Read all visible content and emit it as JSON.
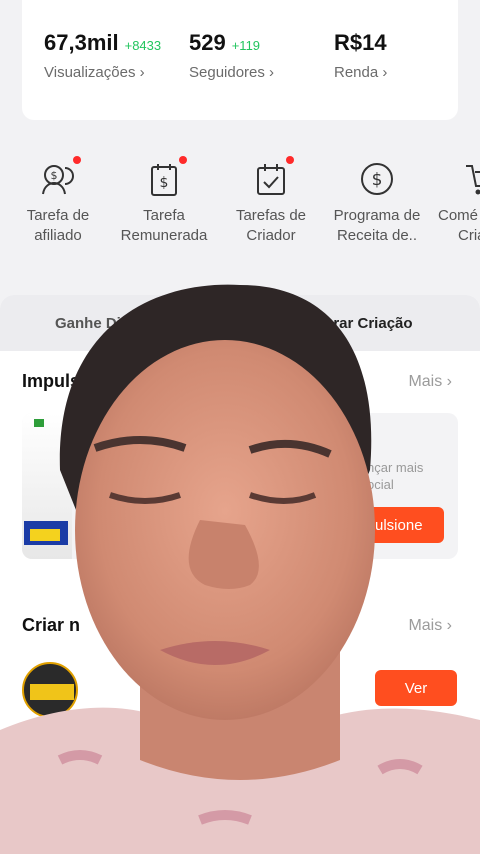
{
  "stats": [
    {
      "value": "67,3mil",
      "delta": "+8433",
      "label": "Visualizações ›"
    },
    {
      "value": "529",
      "delta": "+119",
      "label": "Seguidores ›"
    },
    {
      "value": "R$14",
      "delta": "",
      "label": "Renda ›"
    }
  ],
  "tools": [
    {
      "icon": "affiliate-task-icon",
      "line1": "Tarefa de",
      "line2": "afiliado",
      "has_dot": true
    },
    {
      "icon": "paid-task-icon",
      "line1": "Tarefa",
      "line2": "Remunerada",
      "has_dot": true
    },
    {
      "icon": "creator-tasks-icon",
      "line1": "Tarefas de",
      "line2": "Criador",
      "has_dot": true
    },
    {
      "icon": "revenue-program-icon",
      "line1": "Programa de",
      "line2": "Receita de..",
      "has_dot": false
    },
    {
      "icon": "cart-icon",
      "line1": "Comé",
      "line2": "Cria",
      "has_dot": false
    }
  ],
  "tabs": [
    "Ganhe Di",
    "Melhorar Criação"
  ],
  "sections": {
    "impulsione": {
      "title": "Impuls",
      "more": "Mais ›",
      "text1": "nçar mais",
      "text2": "ocial",
      "button": "Impulsione"
    },
    "criar": {
      "title": "Criar n",
      "more": "Mais ›",
      "button": "Ver"
    }
  },
  "colors": {
    "accent": "#ff4e1f",
    "delta": "#22c55e",
    "dot": "#ff2a2a"
  }
}
